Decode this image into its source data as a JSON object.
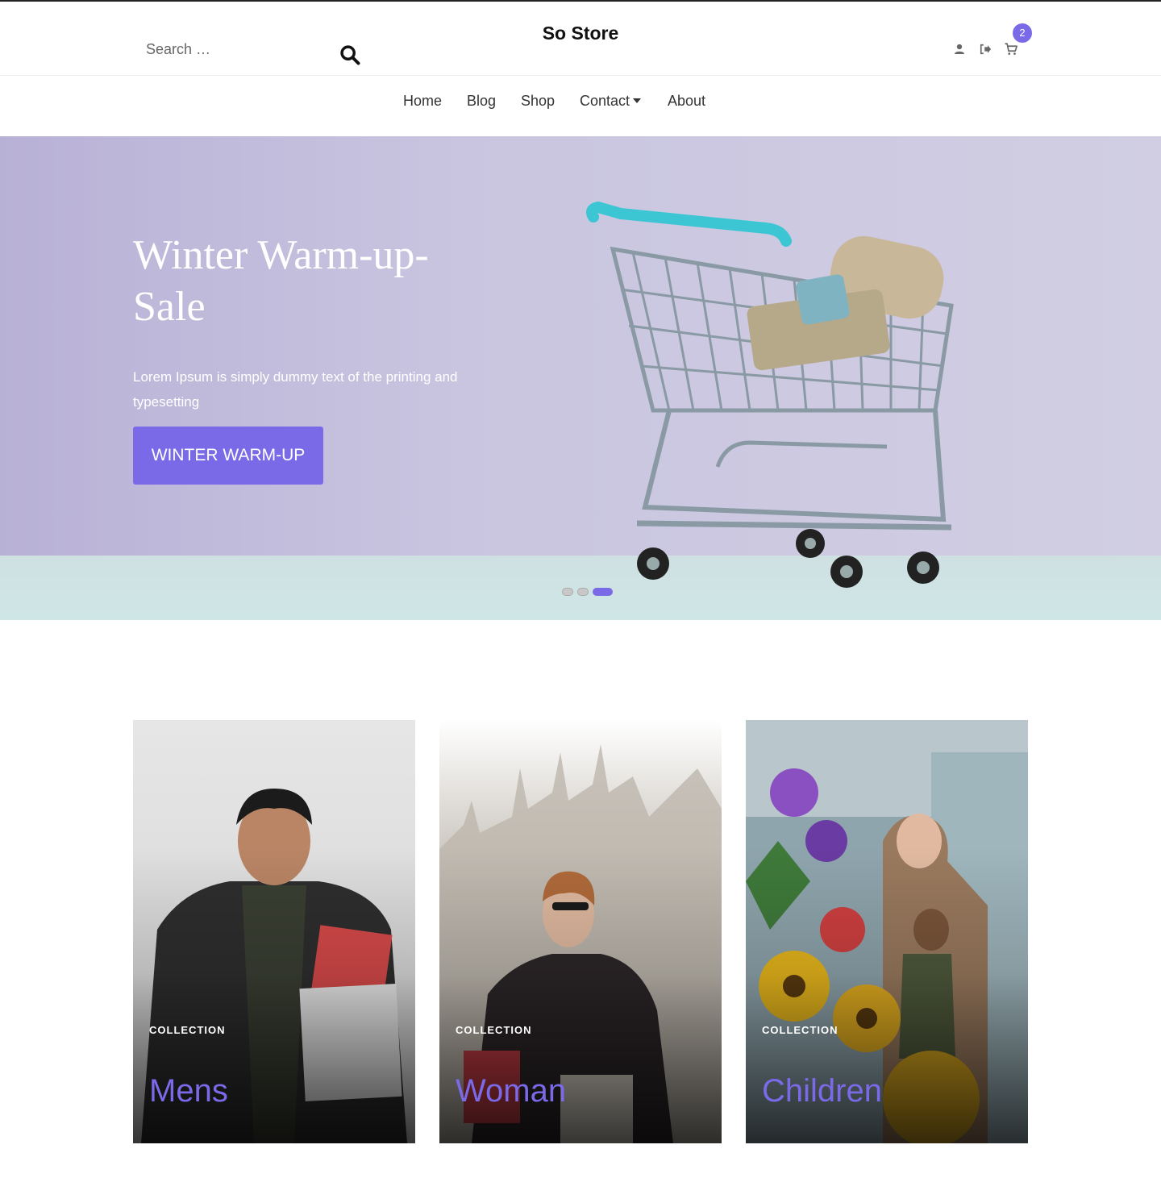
{
  "header": {
    "brand": "So Store",
    "search_placeholder": "Search …",
    "cart_count": "2"
  },
  "nav": {
    "items": [
      "Home",
      "Blog",
      "Shop",
      "Contact",
      "About"
    ]
  },
  "hero": {
    "title": "Winter Warm-up-Sale",
    "subtitle": "Lorem Ipsum is simply dummy text of the printing and typesetting",
    "cta_label": "WINTER WARM-UP",
    "slides_total": 3,
    "active_slide": 3
  },
  "collections": [
    {
      "tag": "COLLECTION",
      "title": "Mens"
    },
    {
      "tag": "COLLECTION",
      "title": "Woman"
    },
    {
      "tag": "COLLECTION",
      "title": "Children"
    }
  ],
  "colors": {
    "accent": "#7a6ae8",
    "hero_bg": "#c9c5e0",
    "text": "#333333"
  },
  "icons": [
    "search-icon",
    "user-icon",
    "logout-icon",
    "cart-icon"
  ]
}
